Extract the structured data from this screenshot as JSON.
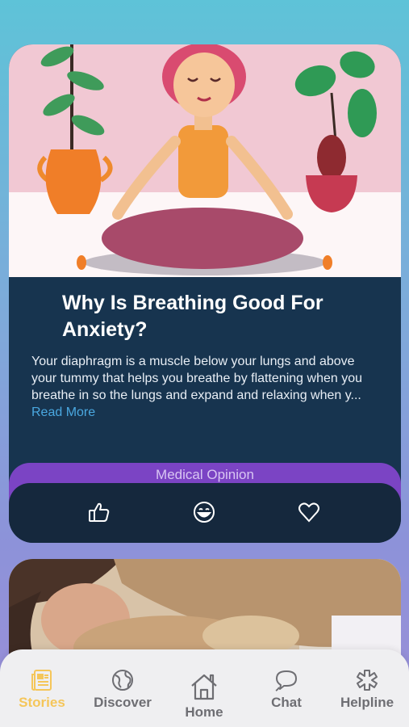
{
  "card": {
    "title": "Why Is Breathing Good For Anxiety?",
    "excerpt": "Your diaphragm is a muscle below your lungs and above your tummy that helps you breathe by flattening when you breathe in so the lungs and expand and relaxing when y...",
    "read_more": "Read More",
    "tag": "Medical Opinion",
    "actions": [
      "thumbs-up-icon",
      "smile-icon",
      "heart-icon"
    ]
  },
  "tabs": [
    {
      "label": "Stories",
      "icon": "stories-icon",
      "active": true
    },
    {
      "label": "Discover",
      "icon": "globe-icon",
      "active": false
    },
    {
      "label": "Home",
      "icon": "home-icon",
      "active": false
    },
    {
      "label": "Chat",
      "icon": "chat-icon",
      "active": false
    },
    {
      "label": "Helpline",
      "icon": "asterisk-icon",
      "active": false
    }
  ],
  "colors": {
    "card_bg": "#17344f",
    "tag_bg": "#7b44c4",
    "accent_active": "#f5c65a",
    "link": "#4aa8e0"
  }
}
